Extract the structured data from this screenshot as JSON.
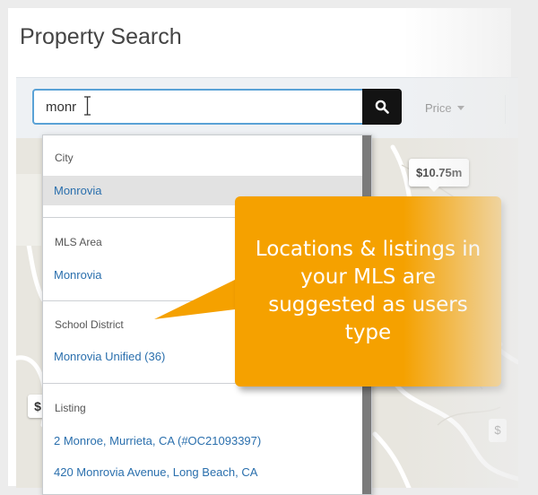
{
  "page": {
    "title": "Property Search"
  },
  "search": {
    "value": "monr"
  },
  "filters": {
    "price_label": "Price"
  },
  "map": {
    "price_pin": "$10.75m",
    "pin_left": "$",
    "pin_right": "$"
  },
  "suggestions": {
    "groups": [
      {
        "header": "City",
        "items": [
          "Monrovia"
        ]
      },
      {
        "header": "MLS Area",
        "items": [
          "Monrovia"
        ]
      },
      {
        "header": "School District",
        "items": [
          "Monrovia Unified (36)"
        ]
      },
      {
        "header": "Listing",
        "items": [
          "2 Monroe, Murrieta, CA (#OC21093397)",
          "420 Monrovia Avenue, Long Beach, CA"
        ]
      }
    ]
  },
  "callout": {
    "text": "Locations & listings in your MLS are suggested as users type"
  },
  "colors": {
    "accent": "#f5a100",
    "link": "#2a6fad",
    "input_border": "#5aa2d6",
    "search_button": "#131313"
  }
}
